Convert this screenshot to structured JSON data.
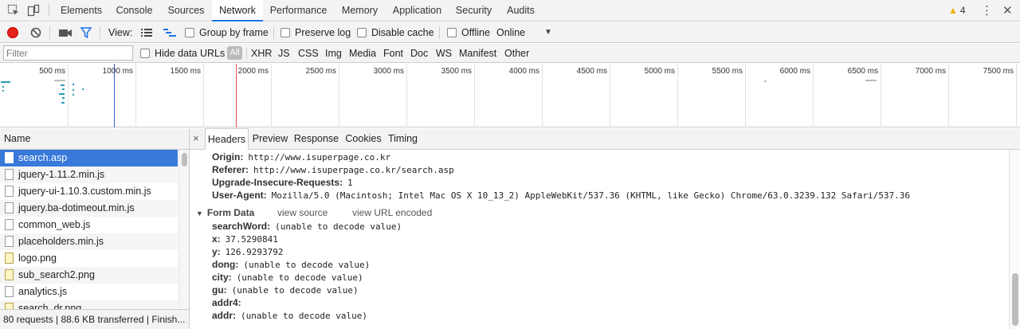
{
  "main_tabs": [
    "Elements",
    "Console",
    "Sources",
    "Network",
    "Performance",
    "Memory",
    "Application",
    "Security",
    "Audits"
  ],
  "active_tab": "Network",
  "warnings": {
    "count": "4"
  },
  "toolbar": {
    "view_label": "View:",
    "group_by_frame": "Group by frame",
    "preserve_log": "Preserve log",
    "disable_cache": "Disable cache",
    "offline": "Offline",
    "throttle": "Online"
  },
  "filter": {
    "placeholder": "Filter",
    "hide_data_urls": "Hide data URLs",
    "all": "All",
    "types": [
      "XHR",
      "JS",
      "CSS",
      "Img",
      "Media",
      "Font",
      "Doc",
      "WS",
      "Manifest",
      "Other"
    ]
  },
  "overview": {
    "ticks": [
      "500 ms",
      "1000 ms",
      "1500 ms",
      "2000 ms",
      "2500 ms",
      "3000 ms",
      "3500 ms",
      "4000 ms",
      "4500 ms",
      "5000 ms",
      "5500 ms",
      "6000 ms",
      "6500 ms",
      "7000 ms",
      "7500 ms"
    ]
  },
  "requests": {
    "header": "Name",
    "items": [
      "search.asp",
      "jquery-1.11.2.min.js",
      "jquery-ui-1.10.3.custom.min.js",
      "jquery.ba-dotimeout.min.js",
      "common_web.js",
      "placeholders.min.js",
      "logo.png",
      "sub_search2.png",
      "analytics.js",
      "search_dr.png"
    ],
    "image_items": [
      6,
      7,
      9
    ],
    "selected": 0
  },
  "status": {
    "text": "80 requests | 88.6 KB transferred | Finish..."
  },
  "detail": {
    "close": "×",
    "tabs": [
      "Headers",
      "Preview",
      "Response",
      "Cookies",
      "Timing"
    ],
    "active_tab": "Headers",
    "request_headers": [
      {
        "key": "Origin:",
        "value": "http://www.isuperpage.co.kr"
      },
      {
        "key": "Referer:",
        "value": "http://www.isuperpage.co.kr/search.asp"
      },
      {
        "key": "Upgrade-Insecure-Requests:",
        "value": "1"
      },
      {
        "key": "User-Agent:",
        "value": "Mozilla/5.0 (Macintosh; Intel Mac OS X 10_13_2) AppleWebKit/537.36 (KHTML, like Gecko) Chrome/63.0.3239.132 Safari/537.36"
      }
    ],
    "form_data": {
      "title": "Form Data",
      "view_source": "view source",
      "view_url_encoded": "view URL encoded",
      "fields": [
        {
          "key": "searchWord:",
          "value": "(unable to decode value)"
        },
        {
          "key": "x:",
          "value": "37.5290841"
        },
        {
          "key": "y:",
          "value": "126.9293792"
        },
        {
          "key": "dong:",
          "value": "(unable to decode value)"
        },
        {
          "key": "city:",
          "value": "(unable to decode value)"
        },
        {
          "key": "gu:",
          "value": "(unable to decode value)"
        },
        {
          "key": "addr4:",
          "value": ""
        },
        {
          "key": "addr:",
          "value": "(unable to decode value)"
        }
      ]
    }
  },
  "colors": {
    "accent": "#1a73e8",
    "selected_row": "#3879d9",
    "record": "#e2231a",
    "warning": "#f0ad00"
  }
}
